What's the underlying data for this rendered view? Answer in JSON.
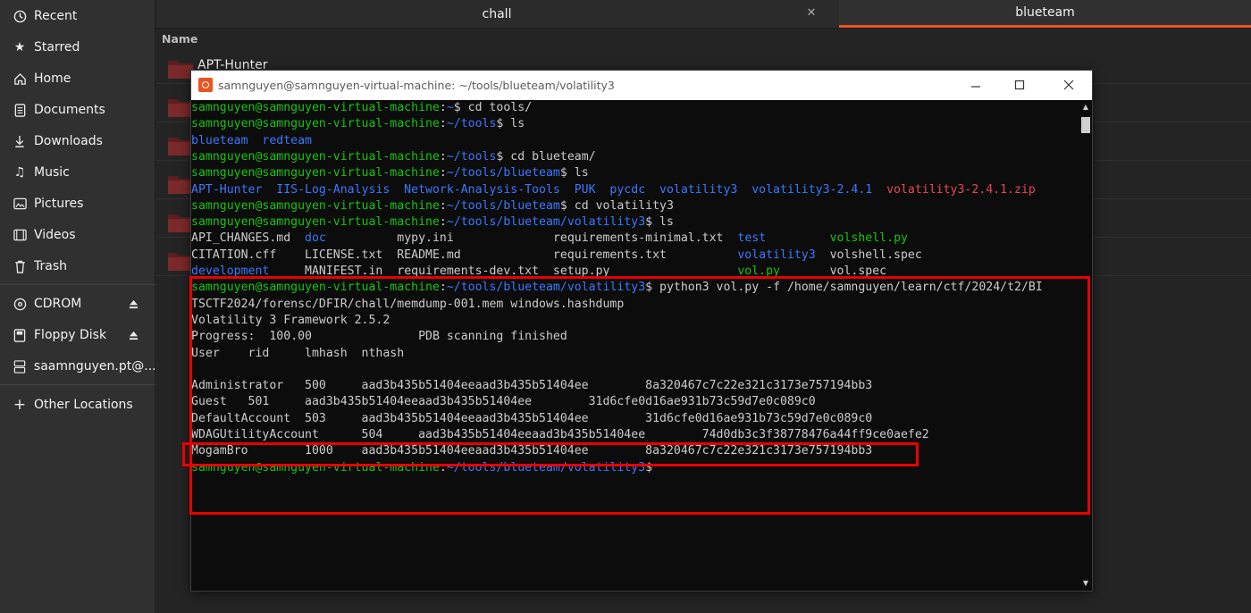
{
  "sidebar": {
    "items": [
      {
        "label": "Recent",
        "icon": "clock-icon"
      },
      {
        "label": "Starred",
        "icon": "star-icon"
      },
      {
        "label": "Home",
        "icon": "home-icon"
      },
      {
        "label": "Documents",
        "icon": "document-icon"
      },
      {
        "label": "Downloads",
        "icon": "download-icon"
      },
      {
        "label": "Music",
        "icon": "music-icon"
      },
      {
        "label": "Pictures",
        "icon": "picture-icon"
      },
      {
        "label": "Videos",
        "icon": "video-icon"
      },
      {
        "label": "Trash",
        "icon": "trash-icon"
      }
    ],
    "devices": [
      {
        "label": "CDROM",
        "icon": "disc-icon"
      },
      {
        "label": "Floppy Disk",
        "icon": "drive-icon"
      },
      {
        "label": "saamnguyen.pt@...",
        "icon": "network-icon"
      }
    ],
    "other": {
      "label": "Other Locations",
      "icon": "plus-icon"
    }
  },
  "tabs": [
    {
      "label": "chall"
    },
    {
      "label": "blueteam"
    }
  ],
  "file_list": {
    "column_name": "Name",
    "files": [
      {
        "name": "APT-Hunter"
      }
    ]
  },
  "terminal": {
    "title": "samnguyen@samnguyen-virtual-machine: ~/tools/blueteam/volatility3",
    "lines": [
      [
        {
          "t": "samnguyen@samnguyen-virtual-machine",
          "c": "g"
        },
        {
          "t": ":",
          "c": "w"
        },
        {
          "t": "~",
          "c": "b"
        },
        {
          "t": "$ cd tools/",
          "c": "w"
        }
      ],
      [
        {
          "t": "samnguyen@samnguyen-virtual-machine",
          "c": "g"
        },
        {
          "t": ":",
          "c": "w"
        },
        {
          "t": "~/tools",
          "c": "b"
        },
        {
          "t": "$ ls",
          "c": "w"
        }
      ],
      [
        {
          "t": "blueteam  redteam",
          "c": "b"
        }
      ],
      [
        {
          "t": "samnguyen@samnguyen-virtual-machine",
          "c": "g"
        },
        {
          "t": ":",
          "c": "w"
        },
        {
          "t": "~/tools",
          "c": "b"
        },
        {
          "t": "$ cd blueteam/",
          "c": "w"
        }
      ],
      [
        {
          "t": "samnguyen@samnguyen-virtual-machine",
          "c": "g"
        },
        {
          "t": ":",
          "c": "w"
        },
        {
          "t": "~/tools/blueteam",
          "c": "b"
        },
        {
          "t": "$ ls",
          "c": "w"
        }
      ],
      [
        {
          "t": "APT-Hunter  IIS-Log-Analysis  Network-Analysis-Tools  PUK  pycdc  volatility3  volatility3-2.4.1  ",
          "c": "b"
        },
        {
          "t": "volatility3-2.4.1.zip",
          "c": "r"
        }
      ],
      [
        {
          "t": "samnguyen@samnguyen-virtual-machine",
          "c": "g"
        },
        {
          "t": ":",
          "c": "w"
        },
        {
          "t": "~/tools/blueteam",
          "c": "b"
        },
        {
          "t": "$ cd volatility3",
          "c": "w"
        }
      ],
      [
        {
          "t": "samnguyen@samnguyen-virtual-machine",
          "c": "g"
        },
        {
          "t": ":",
          "c": "w"
        },
        {
          "t": "~/tools/blueteam/volatility3",
          "c": "b"
        },
        {
          "t": "$ ls",
          "c": "w"
        }
      ],
      [
        {
          "t": "API_CHANGES.md  ",
          "c": "w"
        },
        {
          "t": "doc",
          "c": "b"
        },
        {
          "t": "          mypy.ini              requirements-minimal.txt  ",
          "c": "w"
        },
        {
          "t": "test",
          "c": "b"
        },
        {
          "t": "         ",
          "c": "w"
        },
        {
          "t": "volshell.py",
          "c": "g"
        }
      ],
      [
        {
          "t": "CITATION.cff    LICENSE.txt  README.md             requirements.txt          ",
          "c": "w"
        },
        {
          "t": "volatility3",
          "c": "b"
        },
        {
          "t": "  volshell.spec",
          "c": "w"
        }
      ],
      [
        {
          "t": "development",
          "c": "b"
        },
        {
          "t": "     MANIFEST.in  requirements-dev.txt  setup.py                  ",
          "c": "w"
        },
        {
          "t": "vol.py",
          "c": "g"
        },
        {
          "t": "       vol.spec",
          "c": "w"
        }
      ],
      [
        {
          "t": "samnguyen@samnguyen-virtual-machine",
          "c": "g"
        },
        {
          "t": ":",
          "c": "w"
        },
        {
          "t": "~/tools/blueteam/volatility3",
          "c": "b"
        },
        {
          "t": "$ python3 vol.py -f /home/samnguyen/learn/ctf/2024/t2/BI",
          "c": "w"
        }
      ],
      [
        {
          "t": "TSCTF2024/forensc/DFIR/chall/memdump-001.mem windows.hashdump",
          "c": "w"
        }
      ],
      [
        {
          "t": "Volatility 3 Framework 2.5.2",
          "c": "w"
        }
      ],
      [
        {
          "t": "Progress:  100.00               PDB scanning finished",
          "c": "w"
        }
      ],
      [
        {
          "t": "User    rid     lmhash  nthash",
          "c": "w"
        }
      ],
      [
        {
          "t": "",
          "c": "w"
        }
      ],
      [
        {
          "t": "Administrator   500     aad3b435b51404eeaad3b435b51404ee        8a320467c7c22e321c3173e757194bb3",
          "c": "w"
        }
      ],
      [
        {
          "t": "Guest   501     aad3b435b51404eeaad3b435b51404ee        31d6cfe0d16ae931b73c59d7e0c089c0",
          "c": "w"
        }
      ],
      [
        {
          "t": "DefaultAccount  503     aad3b435b51404eeaad3b435b51404ee        31d6cfe0d16ae931b73c59d7e0c089c0",
          "c": "w"
        }
      ],
      [
        {
          "t": "WDAGUtilityAccount      504     aad3b435b51404eeaad3b435b51404ee        74d0db3c3f38778476a44ff9ce0aefe2",
          "c": "w"
        }
      ],
      [
        {
          "t": "MogamBro        1000    aad3b435b51404eeaad3b435b51404ee        8a320467c7c22e321c3173e757194bb3",
          "c": "w"
        }
      ],
      [
        {
          "t": "samnguyen@samnguyen-virtual-machine",
          "c": "g"
        },
        {
          "t": ":",
          "c": "w"
        },
        {
          "t": "~/tools/blueteam/volatility3",
          "c": "b"
        },
        {
          "t": "$ ",
          "c": "w"
        }
      ]
    ]
  },
  "colors": {
    "accent": "#e95420",
    "prompt_green": "#16c60c",
    "path_blue": "#3b78ff",
    "archive_red": "#e74856",
    "highlight_red": "#ea0000"
  }
}
